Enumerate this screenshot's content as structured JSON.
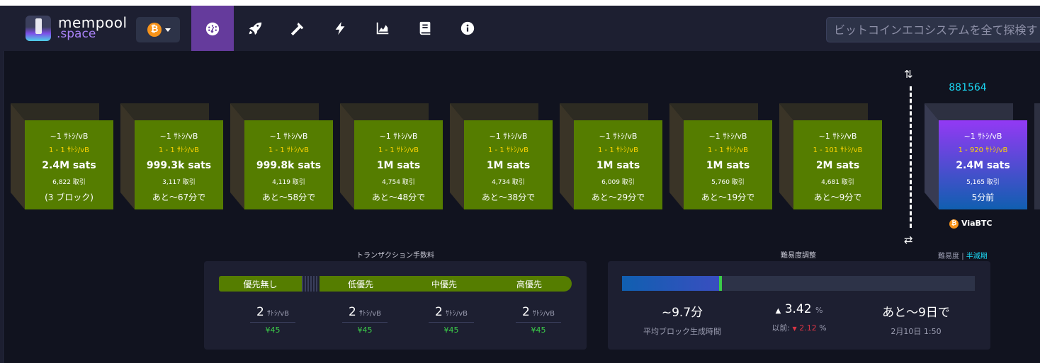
{
  "brand": {
    "line1": "mempool",
    "line2": ".space"
  },
  "network": {
    "icon": "bitcoin-icon",
    "symbol": "₿"
  },
  "nav": [
    {
      "icon": "dashboard-gauge-icon",
      "active": true
    },
    {
      "icon": "rocket-icon",
      "active": false
    },
    {
      "icon": "hammer-icon",
      "active": false
    },
    {
      "icon": "lightning-icon",
      "active": false
    },
    {
      "icon": "chart-area-icon",
      "active": false
    },
    {
      "icon": "book-icon",
      "active": false
    },
    {
      "icon": "info-icon",
      "active": false
    }
  ],
  "search": {
    "placeholder": "ビットコインエコシステムを全て探検す"
  },
  "mempool_blocks": [
    {
      "median": "~1 ｻﾄｼ/vB",
      "range": "1 - 1 ｻﾄｼ/vB",
      "size": "2.4M sats",
      "tx": "6,822 取引",
      "time": "(3 ブロック)"
    },
    {
      "median": "~1 ｻﾄｼ/vB",
      "range": "1 - 1 ｻﾄｼ/vB",
      "size": "999.3k sats",
      "tx": "3,117 取引",
      "time": "あと〜67分で"
    },
    {
      "median": "~1 ｻﾄｼ/vB",
      "range": "1 - 1 ｻﾄｼ/vB",
      "size": "999.8k sats",
      "tx": "4,119 取引",
      "time": "あと〜58分で"
    },
    {
      "median": "~1 ｻﾄｼ/vB",
      "range": "1 - 1 ｻﾄｼ/vB",
      "size": "1M sats",
      "tx": "4,754 取引",
      "time": "あと〜48分で"
    },
    {
      "median": "~1 ｻﾄｼ/vB",
      "range": "1 - 1 ｻﾄｼ/vB",
      "size": "1M sats",
      "tx": "4,734 取引",
      "time": "あと〜38分で"
    },
    {
      "median": "~1 ｻﾄｼ/vB",
      "range": "1 - 1 ｻﾄｼ/vB",
      "size": "1M sats",
      "tx": "6,009 取引",
      "time": "あと〜29分で"
    },
    {
      "median": "~1 ｻﾄｼ/vB",
      "range": "1 - 1 ｻﾄｼ/vB",
      "size": "1M sats",
      "tx": "5,760 取引",
      "time": "あと〜19分で"
    },
    {
      "median": "~1 ｻﾄｼ/vB",
      "range": "1 - 101 ｻﾄｼ/vB",
      "size": "2M sats",
      "tx": "4,681 取引",
      "time": "あと〜9分で"
    }
  ],
  "mined_block": {
    "height": "881564",
    "median": "~1 ｻﾄｼ/vB",
    "range": "1 - 920 ｻﾄｼ/vB",
    "size": "2.4M sats",
    "tx": "5,165 取引",
    "time": "5分前",
    "pool": "ViaBTC"
  },
  "fees": {
    "title": "トランザクション手数料",
    "labels": {
      "none": "優先無し",
      "low": "低優先",
      "mid": "中優先",
      "high": "高優先"
    },
    "unit": "ｻﾄｼ/vB",
    "columns": [
      {
        "value": "2",
        "fiat": "¥45"
      },
      {
        "value": "2",
        "fiat": "¥45"
      },
      {
        "value": "2",
        "fiat": "¥45"
      },
      {
        "value": "2",
        "fiat": "¥45"
      }
    ]
  },
  "difficulty": {
    "title": "難易度調整",
    "progress_pct": 28,
    "avg_block_time": "~9.7分",
    "avg_block_time_label": "平均ブロック生成時間",
    "change_arrow": "▲",
    "change": "3.42",
    "change_unit": "%",
    "previous_label": "以前:",
    "previous_arrow": "▼",
    "previous": "2.12",
    "previous_unit": "%",
    "eta": "あと〜9日で",
    "eta_date": "2月10日 1:50",
    "link_left": "難易度",
    "link_sep": "|",
    "link_right": "半減期"
  },
  "colors": {
    "accent": "#653b9c",
    "block_green": "#557d00",
    "fee_yellow": "#ffd500",
    "height_cyan": "#1bd8f4",
    "positive": "#3bcc49",
    "negative": "#dc3545"
  }
}
